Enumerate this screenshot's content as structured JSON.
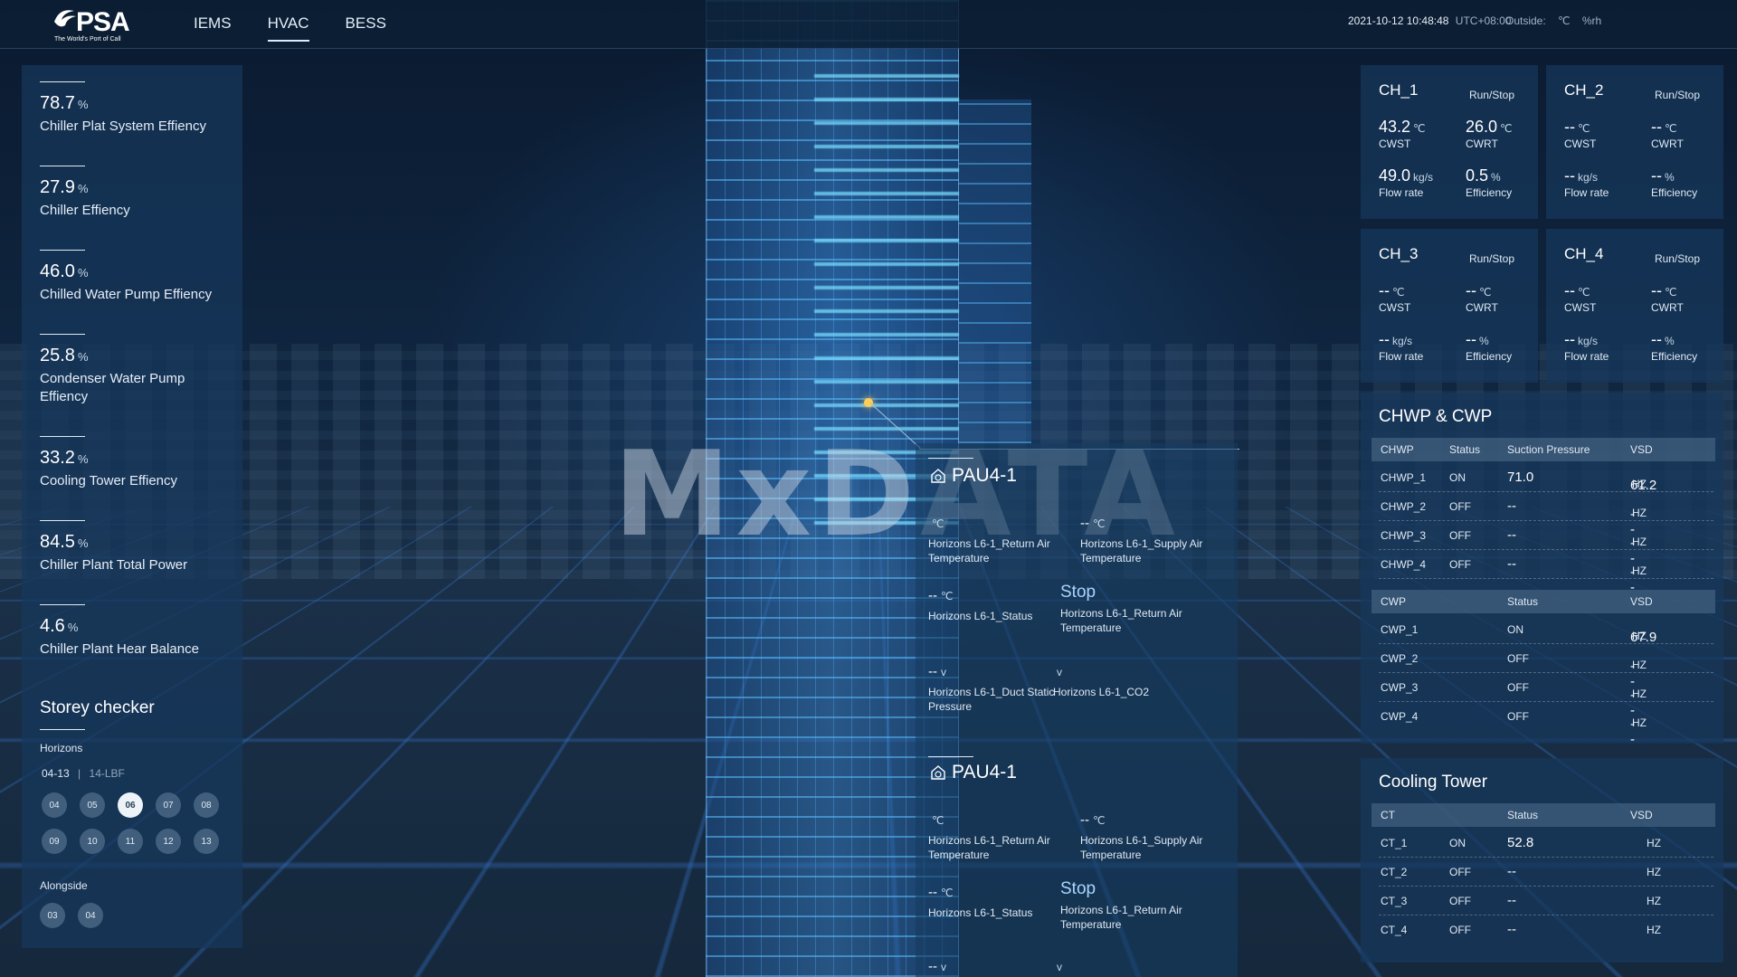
{
  "topbar": {
    "logo_text": "PSA",
    "logo_sub": "The World's Port of Call",
    "nav": [
      "IEMS",
      "HVAC",
      "BESS"
    ],
    "active_nav": "HVAC",
    "datetime": "2021-10-12 10:48:48",
    "timezone": "UTC+08:00",
    "outside_label": "Outside:",
    "outside_temp_unit": "℃",
    "outside_rh_unit": "%rh"
  },
  "watermark": "MxDATA",
  "metrics": [
    {
      "value": "78.7",
      "unit": "%",
      "label": "Chiller Plat System Effiency"
    },
    {
      "value": "27.9",
      "unit": "%",
      "label": "Chiller Effiency"
    },
    {
      "value": "46.0",
      "unit": "%",
      "label": "Chilled Water Pump Effiency"
    },
    {
      "value": "25.8",
      "unit": "%",
      "label": "Condenser Water Pump Effiency"
    },
    {
      "value": "33.2",
      "unit": "%",
      "label": "Cooling Tower Effiency"
    },
    {
      "value": "84.5",
      "unit": "%",
      "label": "Chiller Plant Total Power"
    },
    {
      "value": "4.6",
      "unit": "%",
      "label": "Chiller Plant Hear Balance"
    }
  ],
  "storey": {
    "title": "Storey checker",
    "building": "Horizons",
    "range": "04-13",
    "range_sep": "|",
    "range_extra": "14-LBF",
    "floors": [
      "04",
      "05",
      "06",
      "07",
      "08",
      "09",
      "10",
      "11",
      "12",
      "13"
    ],
    "selected_floor": "06",
    "alongside_title": "Alongside",
    "alongside_floors": [
      "03",
      "04"
    ]
  },
  "chillers": [
    {
      "name": "CH_1",
      "run": "Run/Stop",
      "cwst": "43.2",
      "cwrt": "26.0",
      "flow": "49.0",
      "eff": "0.5"
    },
    {
      "name": "CH_2",
      "run": "Run/Stop",
      "cwst": "--",
      "cwrt": "--",
      "flow": "--",
      "eff": "--"
    },
    {
      "name": "CH_3",
      "run": "Run/Stop",
      "cwst": "--",
      "cwrt": "--",
      "flow": "--",
      "eff": "--"
    },
    {
      "name": "CH_4",
      "run": "Run/Stop",
      "cwst": "--",
      "cwrt": "--",
      "flow": "--",
      "eff": "--"
    }
  ],
  "chiller_labels": {
    "cwst": "CWST",
    "cwrt": "CWRT",
    "flow": "Flow rate",
    "eff": "Efficiency",
    "temp_unit": "℃",
    "flow_unit": "kg/s",
    "eff_unit": "%"
  },
  "chwp_cwp": {
    "title": "CHWP & CWP",
    "chwp_headers": [
      "CHWP",
      "Status",
      "Suction Pressure",
      "VSD"
    ],
    "chwp_rows": [
      {
        "name": "CHWP_1",
        "status": "ON",
        "pressure": "71.0",
        "vsd": "61.2"
      },
      {
        "name": "CHWP_2",
        "status": "OFF",
        "pressure": "--",
        "vsd": "--"
      },
      {
        "name": "CHWP_3",
        "status": "OFF",
        "pressure": "--",
        "vsd": "--"
      },
      {
        "name": "CHWP_4",
        "status": "OFF",
        "pressure": "--",
        "vsd": "--"
      }
    ],
    "cwp_headers": [
      "CWP",
      "Status",
      "VSD"
    ],
    "cwp_rows": [
      {
        "name": "CWP_1",
        "status": "ON",
        "vsd": "67.9"
      },
      {
        "name": "CWP_2",
        "status": "OFF",
        "vsd": "--"
      },
      {
        "name": "CWP_3",
        "status": "OFF",
        "vsd": "--"
      },
      {
        "name": "CWP_4",
        "status": "OFF",
        "vsd": "--"
      }
    ],
    "hz_unit": "HZ"
  },
  "cooling_tower": {
    "title": "Cooling Tower",
    "headers": [
      "CT",
      "Status",
      "VSD"
    ],
    "rows": [
      {
        "name": "CT_1",
        "status": "ON",
        "value": "52.8",
        "unit": "HZ"
      },
      {
        "name": "CT_2",
        "status": "OFF",
        "value": "--",
        "unit": "HZ"
      },
      {
        "name": "CT_3",
        "status": "OFF",
        "value": "--",
        "unit": "HZ"
      },
      {
        "name": "CT_4",
        "status": "OFF",
        "value": "--",
        "unit": "HZ"
      }
    ]
  },
  "pau_blocks": [
    {
      "title": "PAU4-1",
      "return_air_temp": {
        "value": "",
        "unit": "℃",
        "label": "Horizons L6-1_Return Air Temperature"
      },
      "supply_air_temp": {
        "value": "--",
        "unit": "℃",
        "label": "Horizons L6-1_Supply Air Temperature"
      },
      "status": {
        "value": "--",
        "unit": "℃",
        "label": "Horizons L6-1_Status"
      },
      "return_air_status": {
        "value": "Stop",
        "label": "Horizons L6-1_Return Air Temperature"
      },
      "duct_pressure": {
        "value": "--",
        "unit": "v",
        "label": "Horizons L6-1_Duct Static Pressure"
      },
      "co2": {
        "value": "",
        "unit": "v",
        "label": "Horizons L6-1_CO2"
      }
    },
    {
      "title": "PAU4-1",
      "return_air_temp": {
        "value": "",
        "unit": "℃",
        "label": "Horizons L6-1_Return Air Temperature"
      },
      "supply_air_temp": {
        "value": "--",
        "unit": "℃",
        "label": "Horizons L6-1_Supply Air Temperature"
      },
      "status": {
        "value": "--",
        "unit": "℃",
        "label": "Horizons L6-1_Status"
      },
      "return_air_status": {
        "value": "Stop",
        "label": "Horizons L6-1_Return Air Temperature"
      },
      "duct_pressure": {
        "value": "--",
        "unit": "v"
      },
      "co2": {
        "value": "",
        "unit": "v"
      }
    }
  ]
}
